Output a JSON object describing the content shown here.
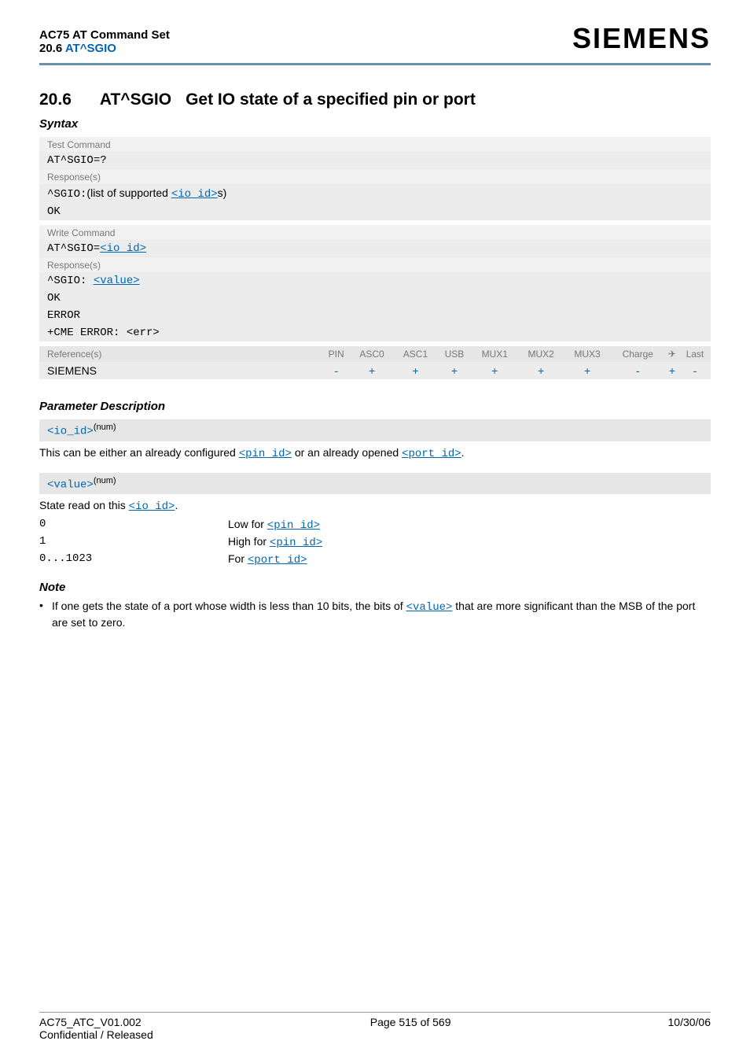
{
  "header": {
    "model": "AC75 AT Command Set",
    "sub_pre": "20.6 ",
    "sub_link": "AT^SGIO",
    "logo": "SIEMENS"
  },
  "section": {
    "num": "20.6",
    "cmd": "AT^SGIO",
    "title": "Get IO state of a specified pin or port"
  },
  "syntax_label": "Syntax",
  "test": {
    "bar": "Test Command",
    "cmd_pre": "AT^SGIO",
    "cmd_post": "=?",
    "resp_bar": "Response(s)",
    "resp_pre": "^SGIO:",
    "resp_mid": "(list of supported ",
    "resp_link": "<io_id>",
    "resp_post": "s)",
    "ok": "OK"
  },
  "write": {
    "bar": "Write Command",
    "cmd_pre": "AT^SGIO=",
    "cmd_link": "<io_id>",
    "resp_bar": "Response(s)",
    "line1_pre": "^SGIO: ",
    "line1_link": "<value>",
    "ok": "OK",
    "err": "ERROR",
    "cme": "+CME ERROR: <err>"
  },
  "ref": {
    "head": [
      "Reference(s)",
      "PIN",
      "ASC0",
      "ASC1",
      "USB",
      "MUX1",
      "MUX2",
      "MUX3",
      "Charge",
      "✈",
      "Last"
    ],
    "name": "SIEMENS",
    "vals": [
      "-",
      "+",
      "+",
      "+",
      "+",
      "+",
      "+",
      "-",
      "+",
      "-"
    ]
  },
  "param_label": "Parameter Description",
  "p1": {
    "name": "<io_id>",
    "sup": "(num)",
    "desc_pre": "This can be either an already configured ",
    "desc_l1": "<pin_id>",
    "desc_mid": " or an already opened ",
    "desc_l2": "<port_id>",
    "desc_post": "."
  },
  "p2": {
    "name": "<value>",
    "sup": "(num)",
    "desc_pre": "State read on this ",
    "desc_link": "<io_id>",
    "desc_post": ".",
    "rows": [
      {
        "v": "0",
        "t_pre": "Low for ",
        "t_link": "<pin_id>"
      },
      {
        "v": "1",
        "t_pre": "High for ",
        "t_link": "<pin_id>"
      },
      {
        "v": "0...1023",
        "t_pre": "For ",
        "t_link": "<port_id>"
      }
    ]
  },
  "note": {
    "h": "Note",
    "pre": "If one gets the state of a port whose width is less than 10 bits, the bits of ",
    "link": "<value>",
    "post": " that are more significant than the MSB of the port are set to zero."
  },
  "footer": {
    "left1": "AC75_ATC_V01.002",
    "left2": "Confidential / Released",
    "mid": "Page 515 of 569",
    "right": "10/30/06"
  }
}
